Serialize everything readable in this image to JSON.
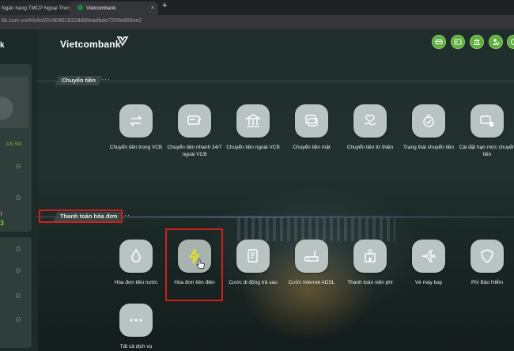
{
  "browser": {
    "tabs": [
      {
        "label": "Ngân hàng TMCP Ngoại Thương",
        "active": false
      },
      {
        "label": "Vietcombank",
        "active": true
      }
    ],
    "new_tab": "+",
    "close": "×",
    "url": "bk.com.vn/#/info/20c90481832dd68eadbde7209e865ee2"
  },
  "sidebar": {
    "logo_fragment": "k",
    "badge_text": "CN SIX",
    "number_label": "7",
    "number_value": "3"
  },
  "header": {
    "brand": "Vietcombank",
    "icons": [
      "card-icon",
      "payment-card-icon",
      "bank-icon",
      "user-settings-icon",
      "logout-icon"
    ],
    "accent_color": "#5fae3e"
  },
  "sections": {
    "transfer": {
      "title": "Chuyển tiền",
      "more": "···",
      "items": [
        {
          "label": "Chuyển tiền trong VCB",
          "icon": "swap-arrows-icon"
        },
        {
          "label": "Chuyển tiền nhanh 24/7 ngoài VCB",
          "icon": "fast-card-icon"
        },
        {
          "label": "Chuyển tiền ngoài VCB",
          "icon": "bank-building-icon"
        },
        {
          "label": "Chuyển tiền mặt",
          "icon": "cash-window-icon"
        },
        {
          "label": "Chuyển tiền từ thiện",
          "icon": "charity-hand-icon"
        },
        {
          "label": "Trạng thái chuyển tiền",
          "icon": "status-timer-icon"
        },
        {
          "label": "Cài đặt hạn mức chuyển tiền",
          "icon": "limit-settings-icon"
        }
      ]
    },
    "bills": {
      "title": "Thanh toán hóa đơn",
      "more": "···",
      "items": [
        {
          "label": "Hóa đơn tiền nước",
          "icon": "water-drop-icon"
        },
        {
          "label": "Hóa đơn tiền điện",
          "icon": "lightning-icon"
        },
        {
          "label": "Cước di động trả sau",
          "icon": "mobile-bill-icon"
        },
        {
          "label": "Cước Internet ADSL",
          "icon": "router-icon"
        },
        {
          "label": "Thanh toán viện phí",
          "icon": "hospital-icon"
        },
        {
          "label": "Vé máy bay",
          "icon": "airplane-icon"
        },
        {
          "label": "Phí Bảo Hiểm",
          "icon": "shield-icon"
        },
        {
          "label": "Tất cả dịch vụ",
          "icon": "more-dots-icon"
        }
      ]
    }
  },
  "highlight_color": "#d0201b"
}
